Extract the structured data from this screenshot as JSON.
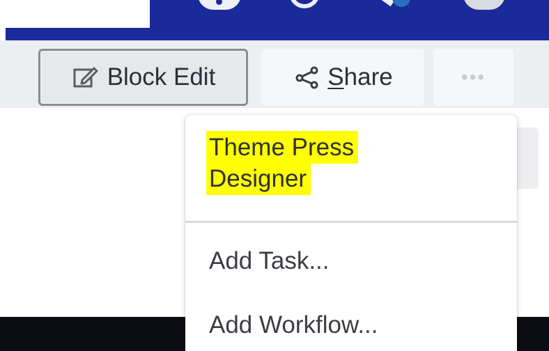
{
  "toolbar": {
    "block_edit_label": "Block Edit",
    "share_label_first": "S",
    "share_label_rest": "hare",
    "more_label": "•••"
  },
  "menu": {
    "items": [
      {
        "label_line1": "Theme Press",
        "label_line2": "Designer",
        "highlighted": true
      },
      {
        "label": "Add Task..."
      },
      {
        "label": "Add Workflow..."
      }
    ]
  },
  "colors": {
    "header": "#1a2a9a",
    "toolbar_bg": "#eceef1",
    "highlight": "#ffff00",
    "text": "#2c2f36"
  },
  "icons": {
    "block_edit": "edit-icon",
    "share": "share-icon",
    "more": "more-dots-icon"
  }
}
